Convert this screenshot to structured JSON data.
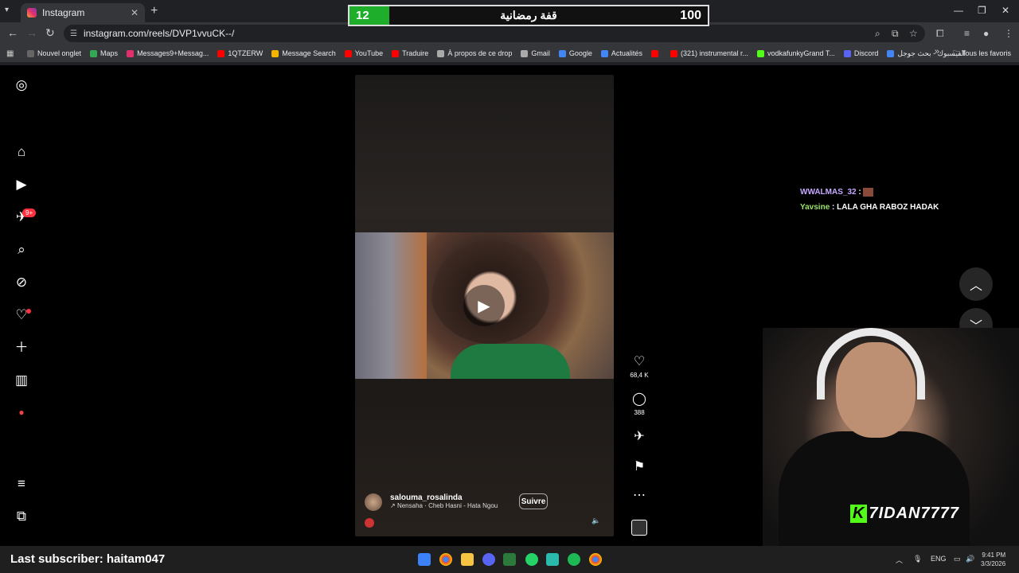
{
  "browser": {
    "tab_title": "Instagram",
    "url": "instagram.com/reels/DVP1vvuCK--/",
    "bookmarks": [
      {
        "label": "Nouvel onglet",
        "color": "#666"
      },
      {
        "label": "Maps",
        "color": "#34a853"
      },
      {
        "label": "Messages9+Messag...",
        "color": "#e1306c"
      },
      {
        "label": "1QTZERW",
        "color": "#ff0000"
      },
      {
        "label": "Message Search",
        "color": "#f4b400"
      },
      {
        "label": "YouTube",
        "color": "#ff0000"
      },
      {
        "label": "Traduire",
        "color": "#ff0000"
      },
      {
        "label": "À propos de ce drop",
        "color": "#aaaaaa"
      },
      {
        "label": "Gmail",
        "color": "#aaaaaa"
      },
      {
        "label": "Google",
        "color": "#4285f4"
      },
      {
        "label": "Actualités",
        "color": "#4285f4"
      },
      {
        "label": "",
        "color": "#ff0000"
      },
      {
        "label": "(321) instrumental r...",
        "color": "#ff0000"
      },
      {
        "label": "vodkafunkyGrand T...",
        "color": "#53fc18"
      },
      {
        "label": "Discord",
        "color": "#5865f2"
      },
      {
        "label": "الفيسبوك - بحث جوجل",
        "color": "#4285f4"
      }
    ],
    "bookmarks_all": "Tous les favoris"
  },
  "overlay": {
    "score_left": "12",
    "title": "قفة رمضانية",
    "score_right": "100"
  },
  "reel": {
    "author": "salouma_rosalinda",
    "music": "Nensaha · Cheb Hasni - Hata Ngou",
    "follow_label": "Suivre",
    "likes": "68,4 K",
    "comments": "388"
  },
  "chat": [
    {
      "user": "WWALMAS_32",
      "sep": " : ",
      "msg": ""
    },
    {
      "user": "Yavsine",
      "sep": " : ",
      "msg": "LALA GHA RABOZ HADAK"
    }
  ],
  "stream": {
    "last_subscriber": "Last subscriber: haitam047",
    "cam_name": "7IDAN7777",
    "cam_badge": "K"
  },
  "tray": {
    "lang": "ENG",
    "time": "9:41 PM",
    "date": "3/3/2026"
  },
  "colors": {
    "score_green": "#1fae2c",
    "kick_green": "#53fc18",
    "notification_red": "#ff3040"
  }
}
